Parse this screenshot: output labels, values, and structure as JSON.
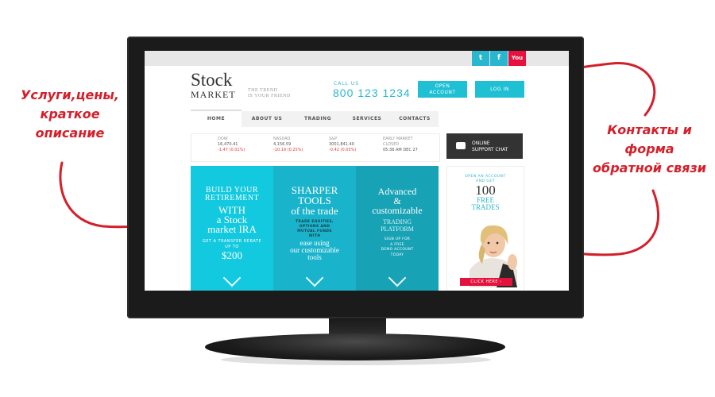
{
  "annotations": {
    "left": "Услуги,цены,\nкраткое\nописание",
    "right": "Контакты и\nформа\nобратной связи"
  },
  "colors": {
    "accent": "#1fc0d4",
    "annotation": "#d41f2a",
    "panel1": "#12c9df",
    "panel2": "#19b4cc",
    "panel3": "#18a2b6",
    "social_red": "#e5123e"
  },
  "social": {
    "twitter": "t",
    "facebook": "f",
    "youtube": "You"
  },
  "logo": {
    "line1": "Stock",
    "line2": "MARKET",
    "tagline1": "THE TREND",
    "tagline2": "IS YOUR FRIEND"
  },
  "contact": {
    "call_label": "CALL US",
    "phone": "800 123 1234"
  },
  "buttons": {
    "open_account": "OPEN ACCOUNT",
    "log_in": "LOG IN"
  },
  "nav": [
    "HOME",
    "ABOUT US",
    "TRADING",
    "SERVICES",
    "CONTACTS"
  ],
  "tickers": [
    {
      "name": "DOW",
      "value": "16,470.41",
      "change": "-1.47 (0.01%)"
    },
    {
      "name": "NASDAQ",
      "value": "4,156.59",
      "change": "-10.19 (0.25%)"
    },
    {
      "name": "S&P",
      "value": "3001,841.40",
      "change": "-0.42 (0.03%)"
    },
    {
      "name": "EARLY MARKET",
      "value": "CLOSED",
      "change": "05:36 AM DEC 27"
    }
  ],
  "support": {
    "line1": "ONLINE",
    "line2": "SUPPORT CHAT"
  },
  "panels": {
    "p1": {
      "h1": "BUILD YOUR",
      "h2": "RETIREMENT",
      "h3": "WITH",
      "h4": "a Stock",
      "h5": "market IRA",
      "sub1": "GET A TRANSFER REBATE",
      "sub2": "UP TO",
      "amount": "$200"
    },
    "p2": {
      "h1": "SHARPER",
      "h2": "TOOLS",
      "h3": "of the trade",
      "sub1": "TRADE EQUITIES,",
      "sub2": "OPTIONS AND",
      "sub3": "MUTUAL FUNDS",
      "sub4": "WITH",
      "e1": "ease using",
      "e2": "our customizable",
      "e3": "tools"
    },
    "p3": {
      "h1": "Advanced",
      "h2": "&",
      "h3": "customizable",
      "h4": "TRADING",
      "h5": "PLATFORM",
      "sub1": "SIGN UP FOR",
      "sub2": "A FREE",
      "sub3": "DEMO ACCOUNT",
      "sub4": "TODAY"
    }
  },
  "promo": {
    "line1": "OPEN AN ACCOUNT",
    "line2": "AND GET",
    "big": "100",
    "free": "FREE",
    "trades": "TRADES",
    "cta": "CLICK HERE ›"
  }
}
